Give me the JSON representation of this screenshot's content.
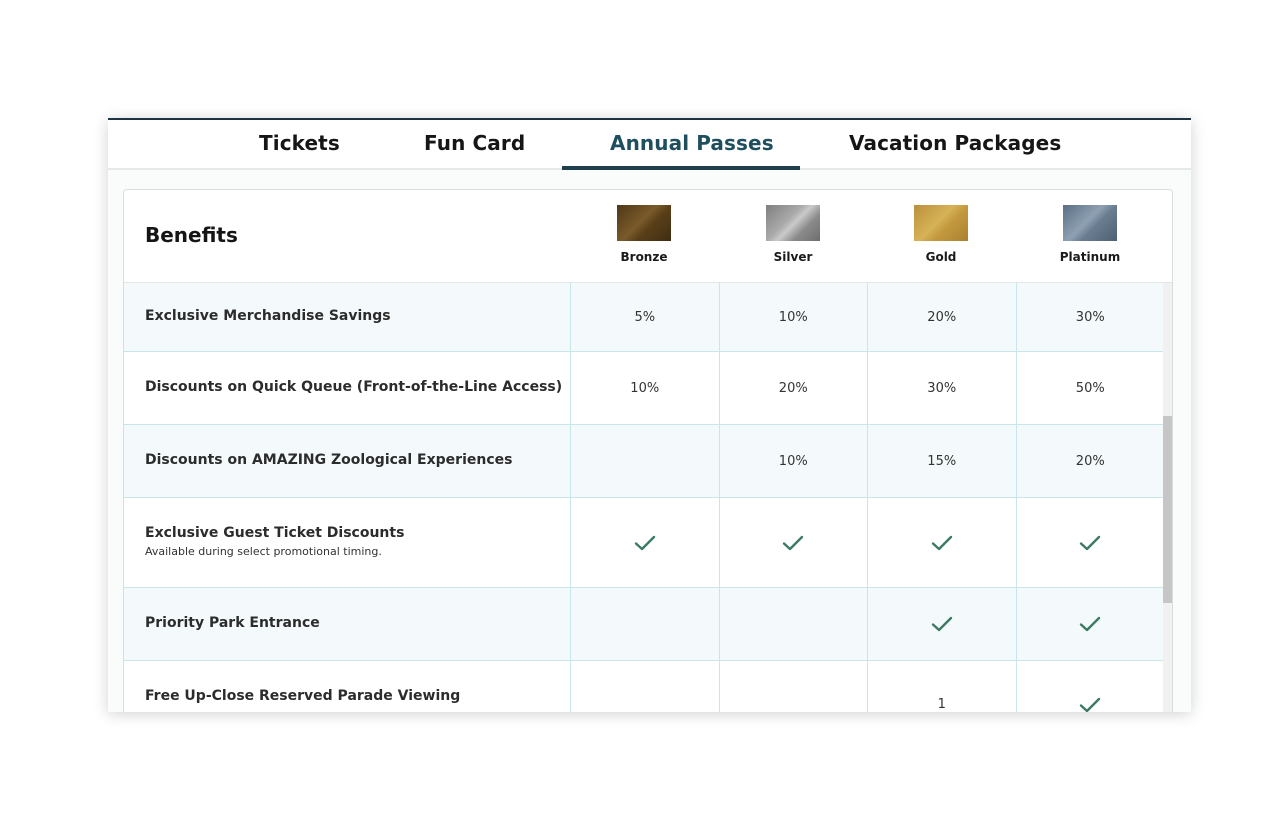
{
  "tabs": [
    {
      "label": "Tickets",
      "active": false
    },
    {
      "label": "Fun Card",
      "active": false
    },
    {
      "label": "Annual Passes",
      "active": true
    },
    {
      "label": "Vacation Packages",
      "active": false
    }
  ],
  "benefits_title": "Benefits",
  "tiers": [
    "Bronze",
    "Silver",
    "Gold",
    "Platinum"
  ],
  "rows": [
    {
      "label": "Exclusive Merchandise Savings",
      "sub": "",
      "values": [
        "5%",
        "10%",
        "20%",
        "30%"
      ]
    },
    {
      "label": "Discounts on Quick Queue (Front-of-the-Line Access)",
      "sub": "",
      "values": [
        "10%",
        "20%",
        "30%",
        "50%"
      ]
    },
    {
      "label": "Discounts on AMAZING Zoological Experiences",
      "sub": "",
      "values": [
        "",
        "10%",
        "15%",
        "20%"
      ]
    },
    {
      "label": "Exclusive Guest Ticket Discounts",
      "sub": "Available during select promotional timing.",
      "values": [
        "check",
        "check",
        "check",
        "check"
      ]
    },
    {
      "label": "Priority Park Entrance",
      "sub": "",
      "values": [
        "",
        "",
        "check",
        "check"
      ]
    },
    {
      "label": "Free Up-Close Reserved Parade Viewing",
      "sub": "",
      "values": [
        "",
        "",
        "1",
        "check"
      ]
    }
  ],
  "colors": {
    "accent": "#1f4f5f",
    "check": "#3d7a63",
    "grid": "#c9e7ea",
    "row_alt": "#f4fafb"
  }
}
